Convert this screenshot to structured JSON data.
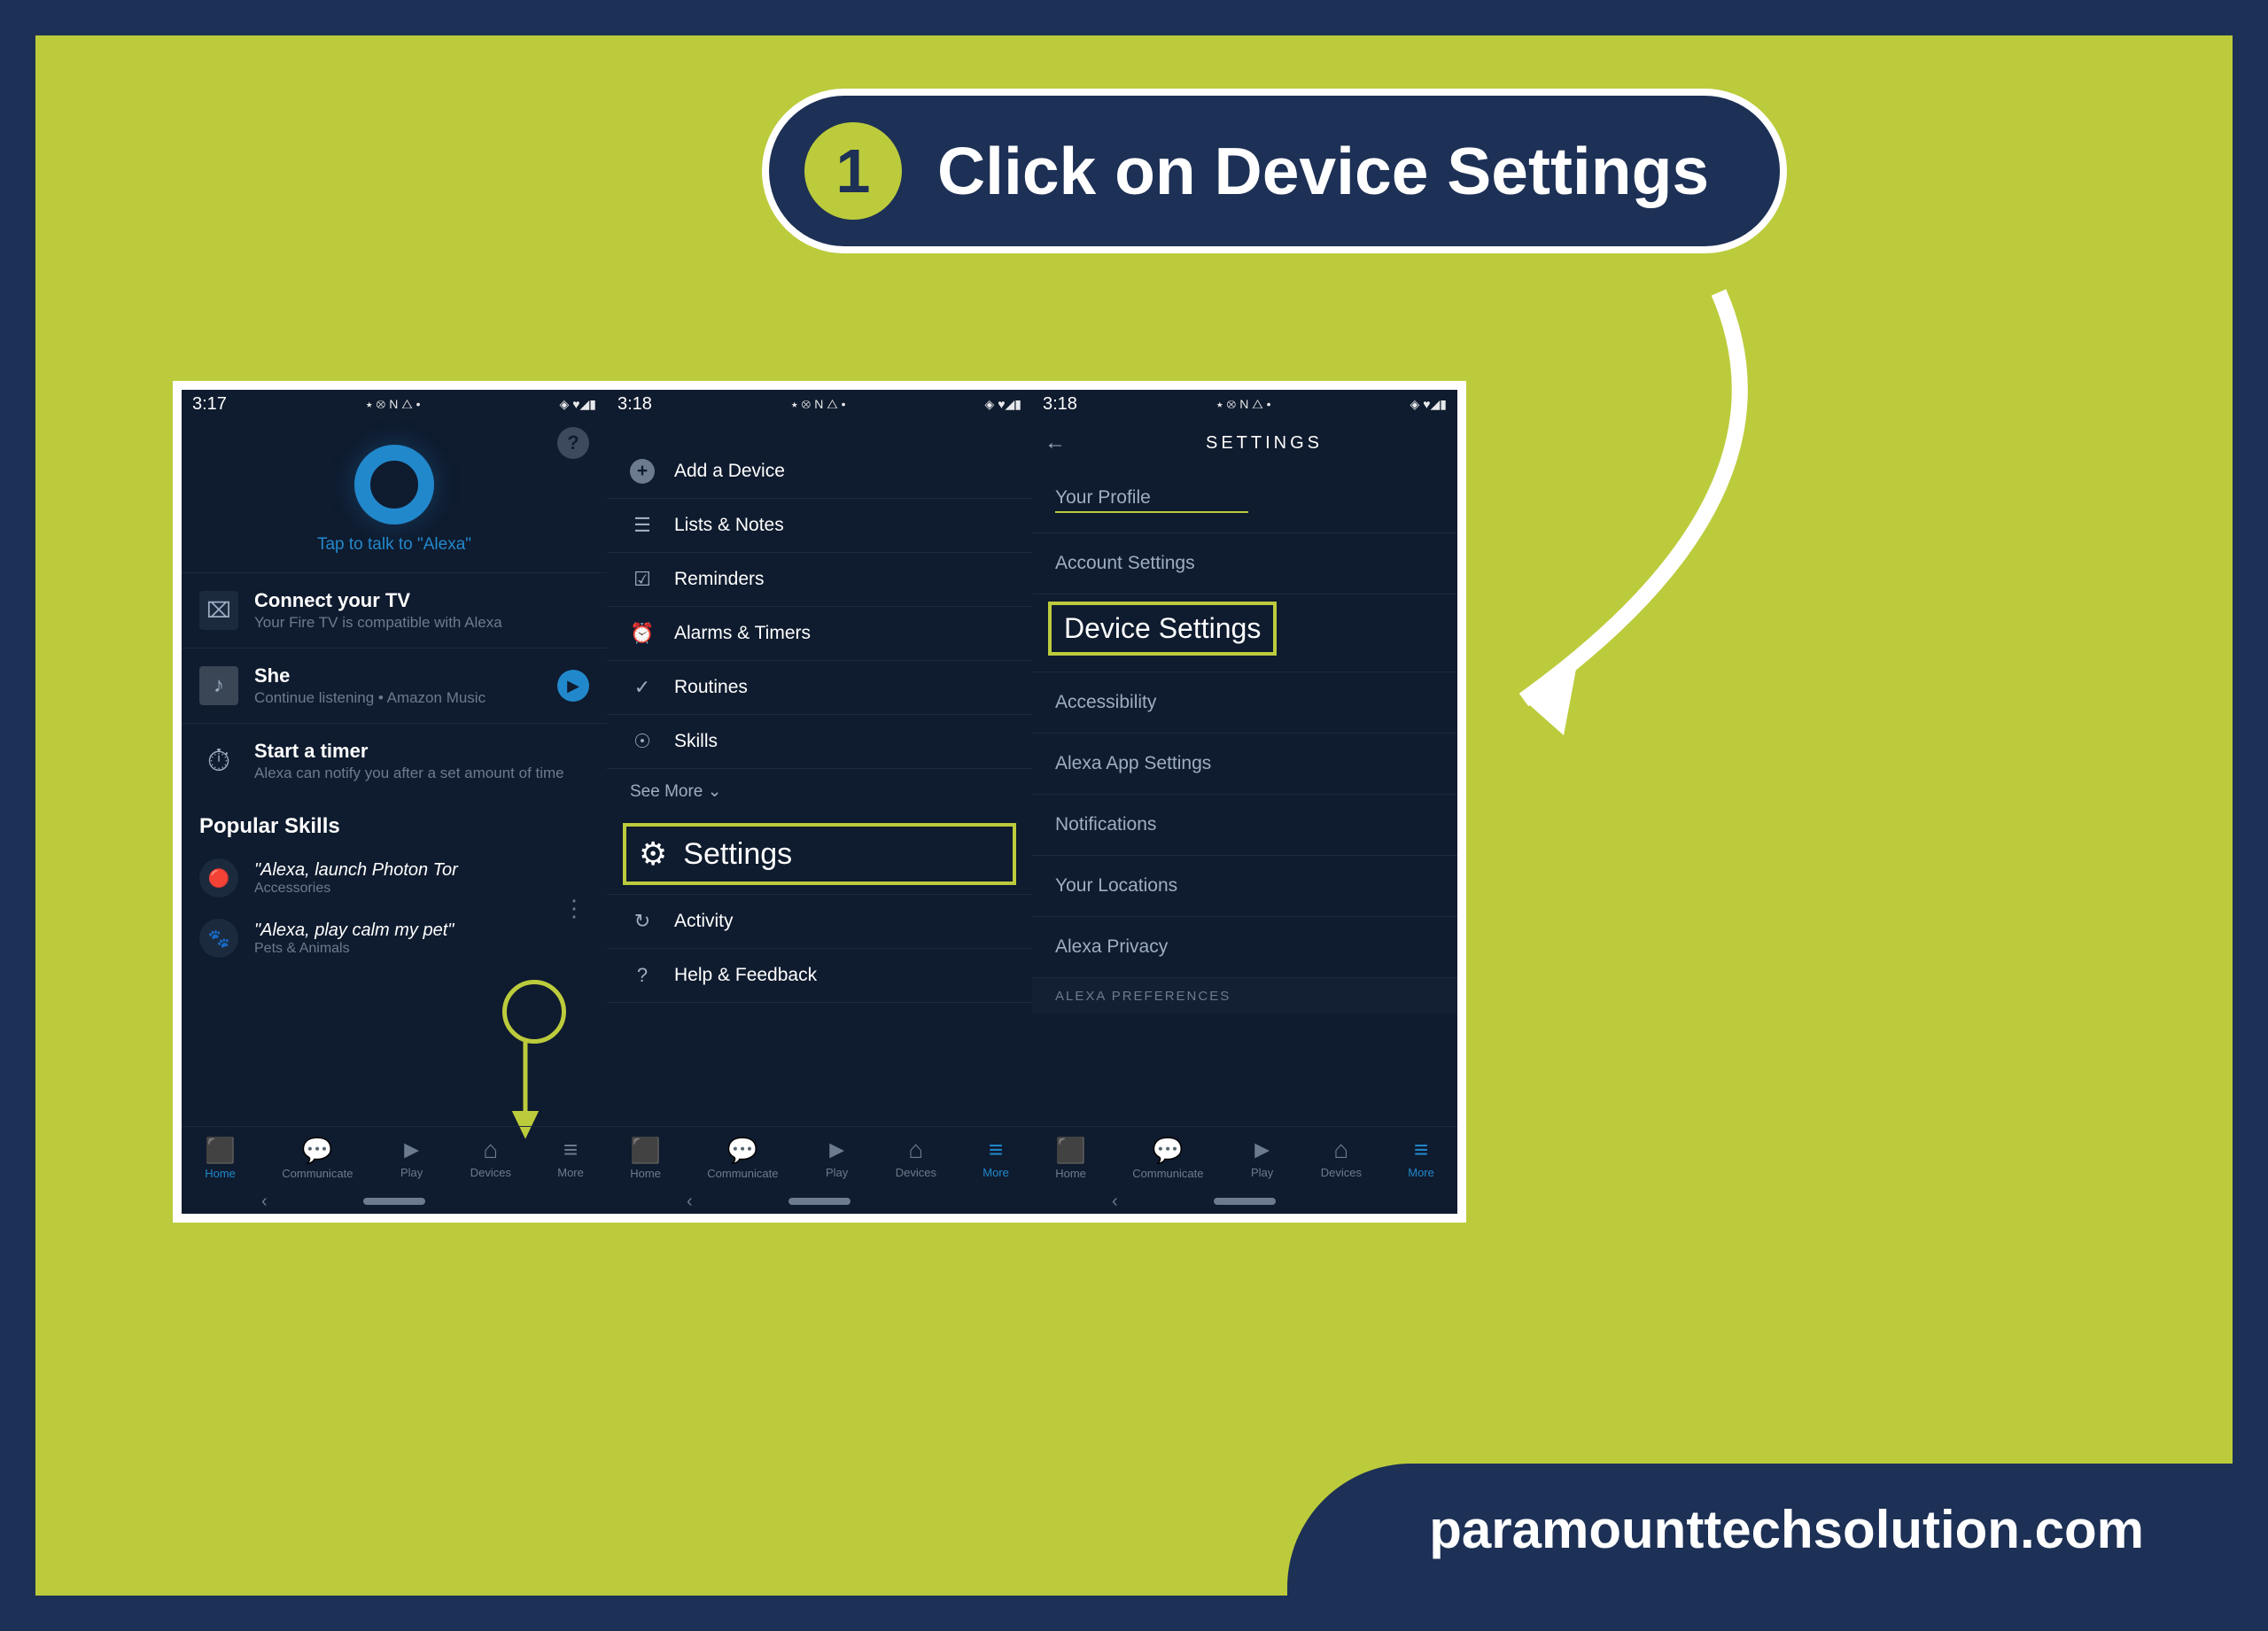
{
  "callout": {
    "step": "1",
    "text": "Click on Device Settings"
  },
  "footer": "paramounttechsolution.com",
  "screens": {
    "s1": {
      "time": "3:17",
      "tap_text": "Tap to talk to \"Alexa\"",
      "cards": {
        "tv": {
          "title": "Connect your TV",
          "sub": "Your Fire TV is compatible with Alexa"
        },
        "she": {
          "title": "She",
          "sub": "Continue listening • Amazon Music"
        },
        "timer": {
          "title": "Start a timer",
          "sub": "Alexa can notify you after a set amount of time"
        }
      },
      "popular": "Popular Skills",
      "skills": {
        "s1": {
          "quote": "\"Alexa, launch Photon Tor",
          "cat": "Accessories"
        },
        "s2": {
          "quote": "\"Alexa, play calm my pet\"",
          "cat": "Pets & Animals"
        }
      }
    },
    "s2": {
      "time": "3:18",
      "menu": {
        "add": "Add a Device",
        "lists": "Lists & Notes",
        "reminders": "Reminders",
        "alarms": "Alarms & Timers",
        "routines": "Routines",
        "skills": "Skills",
        "seemore": "See More  ⌄",
        "settings": "Settings",
        "activity": "Activity",
        "help": "Help & Feedback"
      }
    },
    "s3": {
      "time": "3:18",
      "header": "SETTINGS",
      "rows": {
        "profile": "Your Profile",
        "account": "Account Settings",
        "device": "Device Settings",
        "access": "Accessibility",
        "appset": "Alexa App Settings",
        "notif": "Notifications",
        "loc": "Your Locations",
        "privacy": "Alexa Privacy",
        "section": "ALEXA PREFERENCES"
      }
    },
    "nav": {
      "home": "Home",
      "comm": "Communicate",
      "play": "Play",
      "devices": "Devices",
      "more": "More"
    }
  }
}
